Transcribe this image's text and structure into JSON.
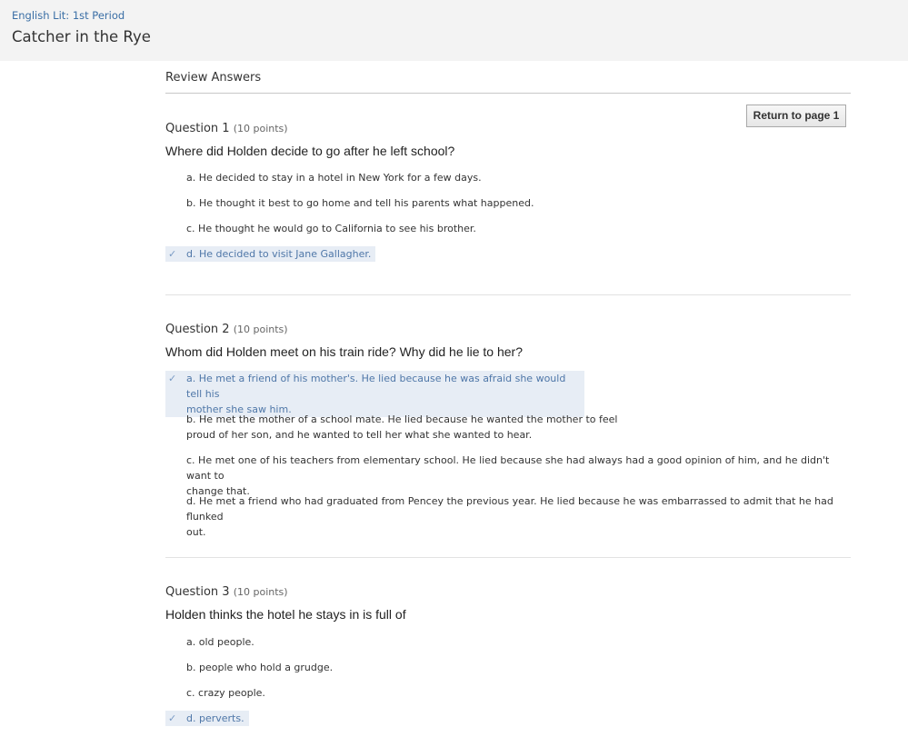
{
  "header": {
    "course": "English Lit: 1st Period",
    "title": "Catcher in the Rye"
  },
  "main": {
    "review_title": "Review Answers",
    "return_button": "Return to page 1"
  },
  "questions": [
    {
      "label": "Question 1",
      "points": "(10 points)",
      "prompt": "Where did Holden decide to go after he left school?",
      "options": [
        {
          "text": "a. He decided to stay in a hotel in New York for a few days.",
          "selected": false
        },
        {
          "text": "b. He thought it best to go home and tell his parents what happened.",
          "selected": false
        },
        {
          "text": "c. He thought he would go to California to see his brother.",
          "selected": false
        },
        {
          "text": "d. He decided to visit Jane Gallagher.",
          "selected": true
        }
      ]
    },
    {
      "label": "Question 2",
      "points": "(10 points)",
      "prompt": "Whom did Holden meet on his train ride? Why did he lie to her?",
      "options": [
        {
          "line1": "a. He met a friend of his mother's. He lied because he was afraid she would tell his",
          "line2": "mother she saw him.",
          "selected": true
        },
        {
          "line1": "b. He met the mother of a school mate. He lied because he wanted the mother to feel",
          "line2": "proud of her son, and he wanted to tell her what she wanted to hear.",
          "selected": false
        },
        {
          "line1": "c. He met one of his teachers from elementary school. He lied because she had always had a good opinion of him, and he didn't want to",
          "line2": "change that.",
          "selected": false
        },
        {
          "line1": "d. He met a friend who had graduated from Pencey the previous year. He lied because he was embarrassed to admit that he had flunked",
          "line2": "out.",
          "selected": false
        }
      ]
    },
    {
      "label": "Question 3",
      "points": "(10 points)",
      "prompt": "Holden thinks the hotel he stays in is full of",
      "options": [
        {
          "text": "a. old people.",
          "selected": false
        },
        {
          "text": "b. people who hold a grudge.",
          "selected": false
        },
        {
          "text": "c. crazy people.",
          "selected": false
        },
        {
          "text": "d. perverts.",
          "selected": true
        }
      ]
    }
  ],
  "icons": {
    "check": "✓",
    "accent": "#4f77a8",
    "selected_bg": "#e7edf5"
  }
}
